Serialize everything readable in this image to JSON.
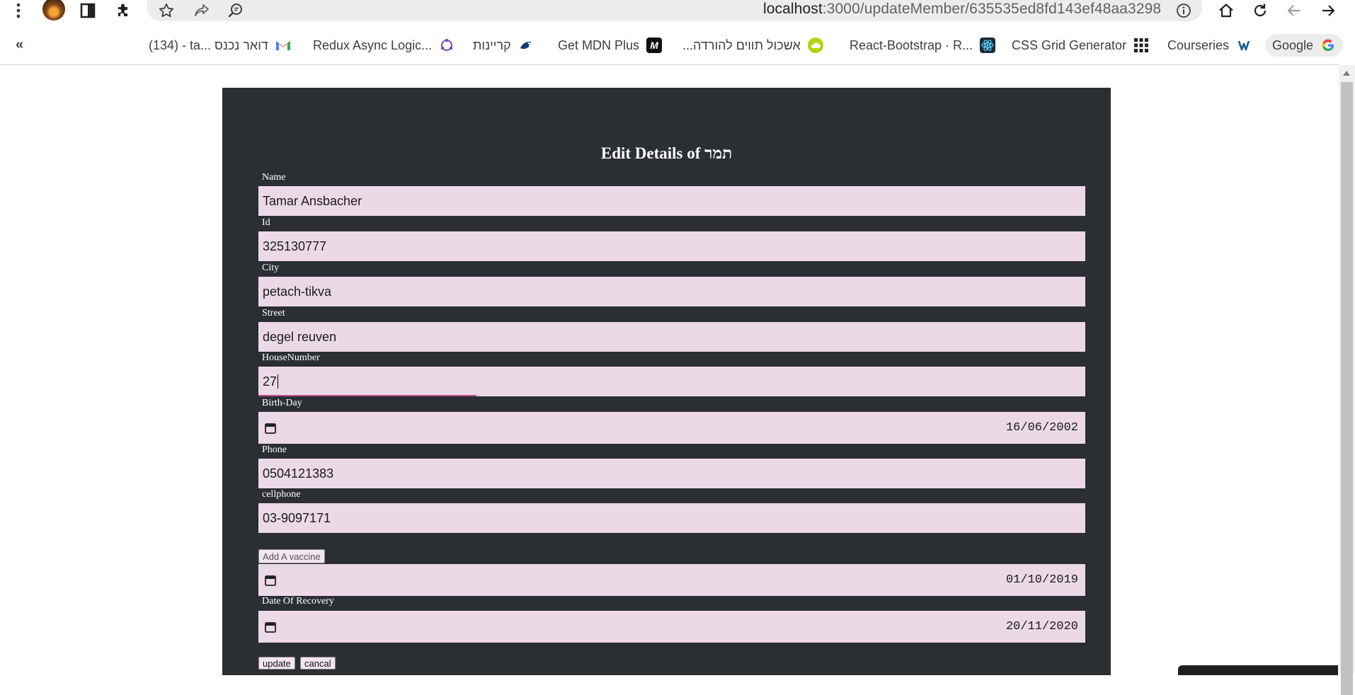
{
  "browser": {
    "url_host": "localhost",
    "url_path": ":3000/updateMember/635535ed8fd143ef48aa3298"
  },
  "bookmarks": {
    "overflow": "«",
    "items": [
      {
        "label": "(134) - ta... דואר נכנס",
        "icon": "gmail-icon"
      },
      {
        "label": "Redux Async Logic...",
        "icon": "redux-icon"
      },
      {
        "label": "קריינות",
        "icon": "bird-icon"
      },
      {
        "label": "Get MDN Plus",
        "icon": "mdn-icon"
      },
      {
        "label": "אשכול תווים להורדה...",
        "icon": "cloud-icon"
      },
      {
        "label": "React-Bootstrap · R...",
        "icon": "react-icon"
      },
      {
        "label": "CSS Grid Generator",
        "icon": "grid-icon"
      },
      {
        "label": "Courseries",
        "icon": "courseries-icon"
      },
      {
        "label": "Google",
        "icon": "google-icon"
      }
    ]
  },
  "form": {
    "title": "Edit Details of תמר",
    "fields": {
      "name": {
        "label": "Name",
        "value": "Tamar Ansbacher"
      },
      "id": {
        "label": "Id",
        "value": "325130777"
      },
      "city": {
        "label": "City",
        "value": "petach-tikva"
      },
      "street": {
        "label": "Street",
        "value": "degel reuven"
      },
      "house_number": {
        "label": "HouseNumber",
        "value": "27"
      },
      "birth_day": {
        "label": "Birth-Day",
        "value": "16/06/2002"
      },
      "phone": {
        "label": "Phone",
        "value": "0504121383"
      },
      "cellphone": {
        "label": "cellphone",
        "value": "03-9097171"
      },
      "vaccine_date": {
        "value": "01/10/2019"
      },
      "date_of_recovery": {
        "label": "Date Of Recovery",
        "value": "20/11/2020"
      }
    },
    "add_vaccine_label": "Add A vaccine",
    "update_label": "update",
    "cancel_label": "cancal"
  },
  "colors": {
    "panel_bg": "#2b2e33",
    "field_bg": "#ecd9e6",
    "focus_underline": "#c0508c"
  }
}
